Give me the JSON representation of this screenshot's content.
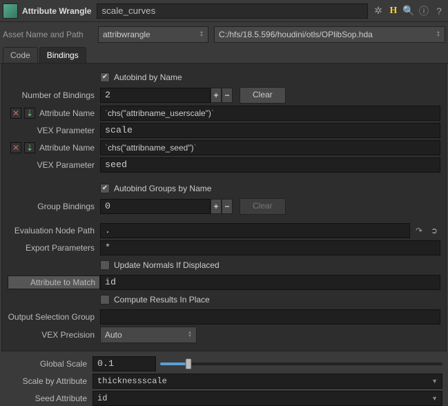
{
  "header": {
    "node_type": "Attribute Wrangle",
    "node_name": "scale_curves"
  },
  "asset": {
    "label": "Asset Name and Path",
    "name": "attribwrangle",
    "path": "C:/hfs/18.5.596/houdini/otls/OPlibSop.hda"
  },
  "tabs": {
    "code": "Code",
    "bindings": "Bindings"
  },
  "params": {
    "autobind_label": "Autobind by Name",
    "num_bindings_label": "Number of Bindings",
    "num_bindings": "2",
    "clear": "Clear",
    "attr_name_label": "Attribute Name",
    "vex_param_label": "VEX Parameter",
    "bindings": [
      {
        "attr_expr": "chs(\"attribname_userscale\")",
        "vex_param": "scale"
      },
      {
        "attr_expr": "chs(\"attribname_seed\")",
        "vex_param": "seed"
      }
    ],
    "autobind_groups_label": "Autobind Groups by Name",
    "group_bindings_label": "Group Bindings",
    "group_bindings": "0",
    "eval_path_label": "Evaluation Node Path",
    "eval_path": ".",
    "export_label": "Export Parameters",
    "export_value": "*",
    "update_normals_label": "Update Normals If Displaced",
    "attr_match_label": "Attribute to Match",
    "attr_match": "id",
    "compute_inplace_label": "Compute Results In Place",
    "out_sel_label": "Output Selection Group",
    "out_sel": "",
    "vex_prec_label": "VEX Precision",
    "vex_prec": "Auto"
  },
  "bottom": {
    "global_scale_label": "Global Scale",
    "global_scale": "0.1",
    "scale_attr_label": "Scale by Attribute",
    "scale_attr": "thicknessscale",
    "seed_attr_label": "Seed Attribute",
    "seed_attr": "id"
  }
}
